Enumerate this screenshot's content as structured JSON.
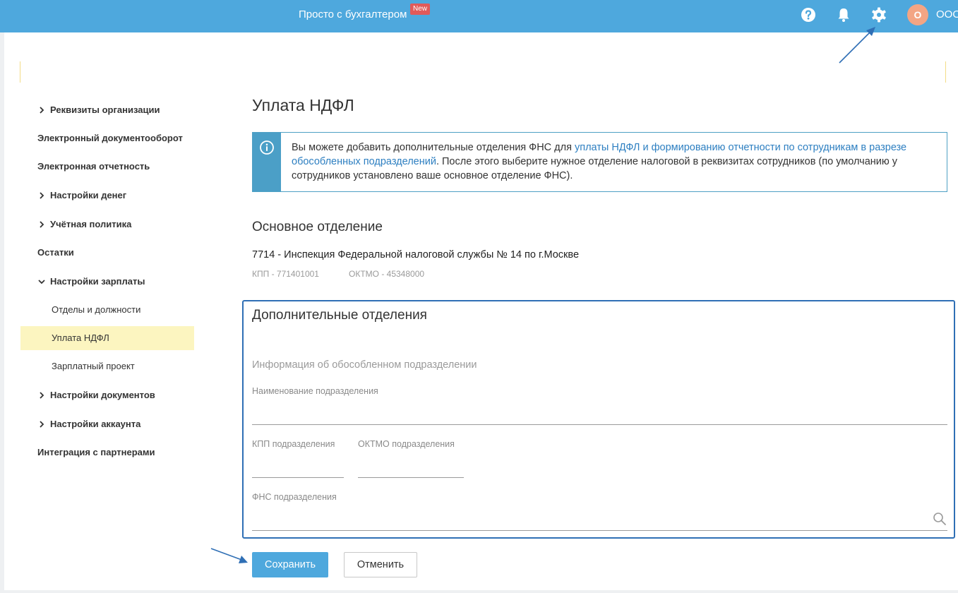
{
  "header": {
    "brand": "Просто с бухгалтером",
    "new_badge": "New",
    "avatar_letter": "О",
    "account_name": "ООО",
    "icons": [
      "help-icon",
      "bell-icon",
      "gear-icon"
    ]
  },
  "sidebar": {
    "items": [
      {
        "label": "Реквизиты организации",
        "arrow": "right"
      },
      {
        "label": "Электронный документооборот"
      },
      {
        "label": "Электронная отчетность"
      },
      {
        "label": "Настройки денег",
        "arrow": "right"
      },
      {
        "label": "Учётная политика",
        "arrow": "right"
      },
      {
        "label": "Остатки"
      },
      {
        "label": "Настройки зарплаты",
        "arrow": "down"
      },
      {
        "label": "Отделы и должности",
        "sub": true
      },
      {
        "label": "Уплата НДФЛ",
        "sub": true,
        "active": true
      },
      {
        "label": "Зарплатный проект",
        "sub": true
      },
      {
        "label": "Настройки документов",
        "arrow": "right"
      },
      {
        "label": "Настройки аккаунта",
        "arrow": "right"
      },
      {
        "label": "Интеграция с партнерами"
      }
    ]
  },
  "main": {
    "title": "Уплата НДФЛ",
    "info": {
      "text_before": "Вы можете добавить дополнительные отделения ФНС для ",
      "link": "уплаты НДФЛ и формированию отчетности по сотрудникам в разрезе обособленных подразделений",
      "text_after": ". После этого выберите нужное отделение налоговой в реквизитах сотрудников (по умолчанию у сотрудников установлено ваше основное отделение ФНС)."
    },
    "main_branch": {
      "title": "Основное отделение",
      "office": "7714 - Инспекция Федеральной налоговой службы № 14 по г.Москве",
      "kpp": "КПП - 771401001",
      "oktmo": "ОКТМО - 45348000"
    },
    "extra": {
      "title": "Дополнительные отделения",
      "subtitle": "Информация об обособленном подразделении",
      "name_label": "Наименование подразделения",
      "name_value": "",
      "kpp_label": "КПП подразделения",
      "kpp_value": "",
      "oktmo_label": "ОКТМО подразделения",
      "oktmo_value": "",
      "fns_label": "ФНС подразделения",
      "fns_value": ""
    },
    "buttons": {
      "save": "Сохранить",
      "cancel": "Отменить"
    }
  },
  "colors": {
    "accent": "#4ea8dd",
    "badge": "#e05a5a",
    "active_item": "#fcf5c0",
    "link": "#2d7fc1",
    "highlight_border": "#2f6fb5"
  }
}
